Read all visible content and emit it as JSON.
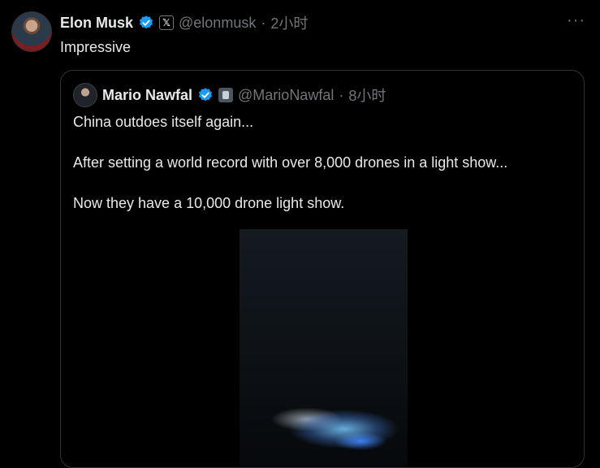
{
  "tweet": {
    "author_name": "Elon Musk",
    "handle": "@elonmusk",
    "separator": "·",
    "time": "2小时",
    "text": "Impressive",
    "more_label": "···",
    "badge_label": "𝕏"
  },
  "quote": {
    "author_name": "Mario Nawfal",
    "handle": "@MarioNawfal",
    "separator": "·",
    "time": "8小时",
    "lines": [
      "China outdoes itself again...",
      "After setting a world record with over 8,000 drones in a light show...",
      "Now they have a 10,000 drone light show."
    ]
  },
  "colors": {
    "background": "#000000",
    "text_primary": "#e7e9ea",
    "text_secondary": "#71767b",
    "verified": "#1d9bf0",
    "border": "#2f3336"
  },
  "icons": {
    "verified": "verified-badge-icon",
    "x_badge": "x-logo-icon",
    "more": "more-horizontal-icon"
  }
}
